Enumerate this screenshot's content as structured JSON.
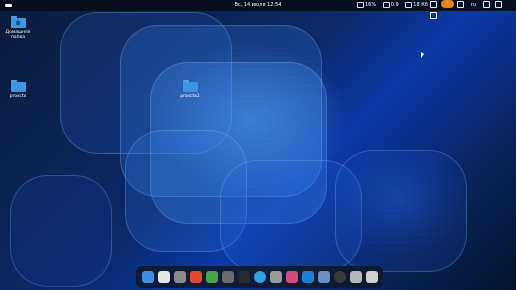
{
  "topbar": {
    "clock": "Вс, 14 июля  12:54",
    "battery": "16%",
    "messages": "0.9",
    "updates": "18 Кб",
    "alert_badge": "!",
    "lang": "ru"
  },
  "desktop": {
    "items": [
      {
        "label_line1": "Домашняя",
        "label_line2": "папка",
        "icon": "home-folder-icon"
      },
      {
        "label_line1": "proxctx",
        "icon": "folder-icon"
      },
      {
        "label_line1": "proxctx2",
        "icon": "folder-icon"
      }
    ]
  },
  "dock": {
    "apps": [
      {
        "name": "files",
        "color": "#3b8ee0"
      },
      {
        "name": "text-editor",
        "color": "#e6e6e6"
      },
      {
        "name": "archive",
        "color": "#8a8a8a"
      },
      {
        "name": "brave",
        "color": "#e34b2e"
      },
      {
        "name": "layers-app",
        "color": "#4aa34a"
      },
      {
        "name": "manager",
        "color": "#6a6a6a"
      },
      {
        "name": "terminal",
        "color": "#2a2a2a"
      },
      {
        "name": "telegram",
        "color": "#2aa3df"
      },
      {
        "name": "ghost-app",
        "color": "#9a9a9a"
      },
      {
        "name": "color-picker",
        "color": "#d24a7a"
      },
      {
        "name": "vscode",
        "color": "#1c7fd6"
      },
      {
        "name": "monitor",
        "color": "#6b8fc0"
      },
      {
        "name": "obs",
        "color": "#3a3a3a"
      },
      {
        "name": "trash",
        "color": "#b8b8b8"
      },
      {
        "name": "app-grid",
        "color": "#cfcfcf"
      }
    ]
  }
}
